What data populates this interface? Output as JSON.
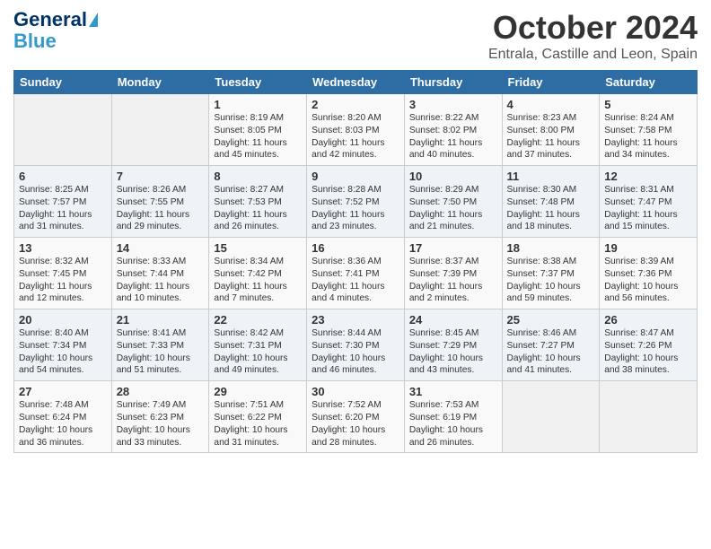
{
  "header": {
    "logo_line1": "General",
    "logo_line2": "Blue",
    "month": "October 2024",
    "location": "Entrala, Castille and Leon, Spain"
  },
  "weekdays": [
    "Sunday",
    "Monday",
    "Tuesday",
    "Wednesday",
    "Thursday",
    "Friday",
    "Saturday"
  ],
  "weeks": [
    [
      {
        "day": "",
        "info": ""
      },
      {
        "day": "",
        "info": ""
      },
      {
        "day": "1",
        "info": "Sunrise: 8:19 AM\nSunset: 8:05 PM\nDaylight: 11 hours and 45 minutes."
      },
      {
        "day": "2",
        "info": "Sunrise: 8:20 AM\nSunset: 8:03 PM\nDaylight: 11 hours and 42 minutes."
      },
      {
        "day": "3",
        "info": "Sunrise: 8:22 AM\nSunset: 8:02 PM\nDaylight: 11 hours and 40 minutes."
      },
      {
        "day": "4",
        "info": "Sunrise: 8:23 AM\nSunset: 8:00 PM\nDaylight: 11 hours and 37 minutes."
      },
      {
        "day": "5",
        "info": "Sunrise: 8:24 AM\nSunset: 7:58 PM\nDaylight: 11 hours and 34 minutes."
      }
    ],
    [
      {
        "day": "6",
        "info": "Sunrise: 8:25 AM\nSunset: 7:57 PM\nDaylight: 11 hours and 31 minutes."
      },
      {
        "day": "7",
        "info": "Sunrise: 8:26 AM\nSunset: 7:55 PM\nDaylight: 11 hours and 29 minutes."
      },
      {
        "day": "8",
        "info": "Sunrise: 8:27 AM\nSunset: 7:53 PM\nDaylight: 11 hours and 26 minutes."
      },
      {
        "day": "9",
        "info": "Sunrise: 8:28 AM\nSunset: 7:52 PM\nDaylight: 11 hours and 23 minutes."
      },
      {
        "day": "10",
        "info": "Sunrise: 8:29 AM\nSunset: 7:50 PM\nDaylight: 11 hours and 21 minutes."
      },
      {
        "day": "11",
        "info": "Sunrise: 8:30 AM\nSunset: 7:48 PM\nDaylight: 11 hours and 18 minutes."
      },
      {
        "day": "12",
        "info": "Sunrise: 8:31 AM\nSunset: 7:47 PM\nDaylight: 11 hours and 15 minutes."
      }
    ],
    [
      {
        "day": "13",
        "info": "Sunrise: 8:32 AM\nSunset: 7:45 PM\nDaylight: 11 hours and 12 minutes."
      },
      {
        "day": "14",
        "info": "Sunrise: 8:33 AM\nSunset: 7:44 PM\nDaylight: 11 hours and 10 minutes."
      },
      {
        "day": "15",
        "info": "Sunrise: 8:34 AM\nSunset: 7:42 PM\nDaylight: 11 hours and 7 minutes."
      },
      {
        "day": "16",
        "info": "Sunrise: 8:36 AM\nSunset: 7:41 PM\nDaylight: 11 hours and 4 minutes."
      },
      {
        "day": "17",
        "info": "Sunrise: 8:37 AM\nSunset: 7:39 PM\nDaylight: 11 hours and 2 minutes."
      },
      {
        "day": "18",
        "info": "Sunrise: 8:38 AM\nSunset: 7:37 PM\nDaylight: 10 hours and 59 minutes."
      },
      {
        "day": "19",
        "info": "Sunrise: 8:39 AM\nSunset: 7:36 PM\nDaylight: 10 hours and 56 minutes."
      }
    ],
    [
      {
        "day": "20",
        "info": "Sunrise: 8:40 AM\nSunset: 7:34 PM\nDaylight: 10 hours and 54 minutes."
      },
      {
        "day": "21",
        "info": "Sunrise: 8:41 AM\nSunset: 7:33 PM\nDaylight: 10 hours and 51 minutes."
      },
      {
        "day": "22",
        "info": "Sunrise: 8:42 AM\nSunset: 7:31 PM\nDaylight: 10 hours and 49 minutes."
      },
      {
        "day": "23",
        "info": "Sunrise: 8:44 AM\nSunset: 7:30 PM\nDaylight: 10 hours and 46 minutes."
      },
      {
        "day": "24",
        "info": "Sunrise: 8:45 AM\nSunset: 7:29 PM\nDaylight: 10 hours and 43 minutes."
      },
      {
        "day": "25",
        "info": "Sunrise: 8:46 AM\nSunset: 7:27 PM\nDaylight: 10 hours and 41 minutes."
      },
      {
        "day": "26",
        "info": "Sunrise: 8:47 AM\nSunset: 7:26 PM\nDaylight: 10 hours and 38 minutes."
      }
    ],
    [
      {
        "day": "27",
        "info": "Sunrise: 7:48 AM\nSunset: 6:24 PM\nDaylight: 10 hours and 36 minutes."
      },
      {
        "day": "28",
        "info": "Sunrise: 7:49 AM\nSunset: 6:23 PM\nDaylight: 10 hours and 33 minutes."
      },
      {
        "day": "29",
        "info": "Sunrise: 7:51 AM\nSunset: 6:22 PM\nDaylight: 10 hours and 31 minutes."
      },
      {
        "day": "30",
        "info": "Sunrise: 7:52 AM\nSunset: 6:20 PM\nDaylight: 10 hours and 28 minutes."
      },
      {
        "day": "31",
        "info": "Sunrise: 7:53 AM\nSunset: 6:19 PM\nDaylight: 10 hours and 26 minutes."
      },
      {
        "day": "",
        "info": ""
      },
      {
        "day": "",
        "info": ""
      }
    ]
  ]
}
